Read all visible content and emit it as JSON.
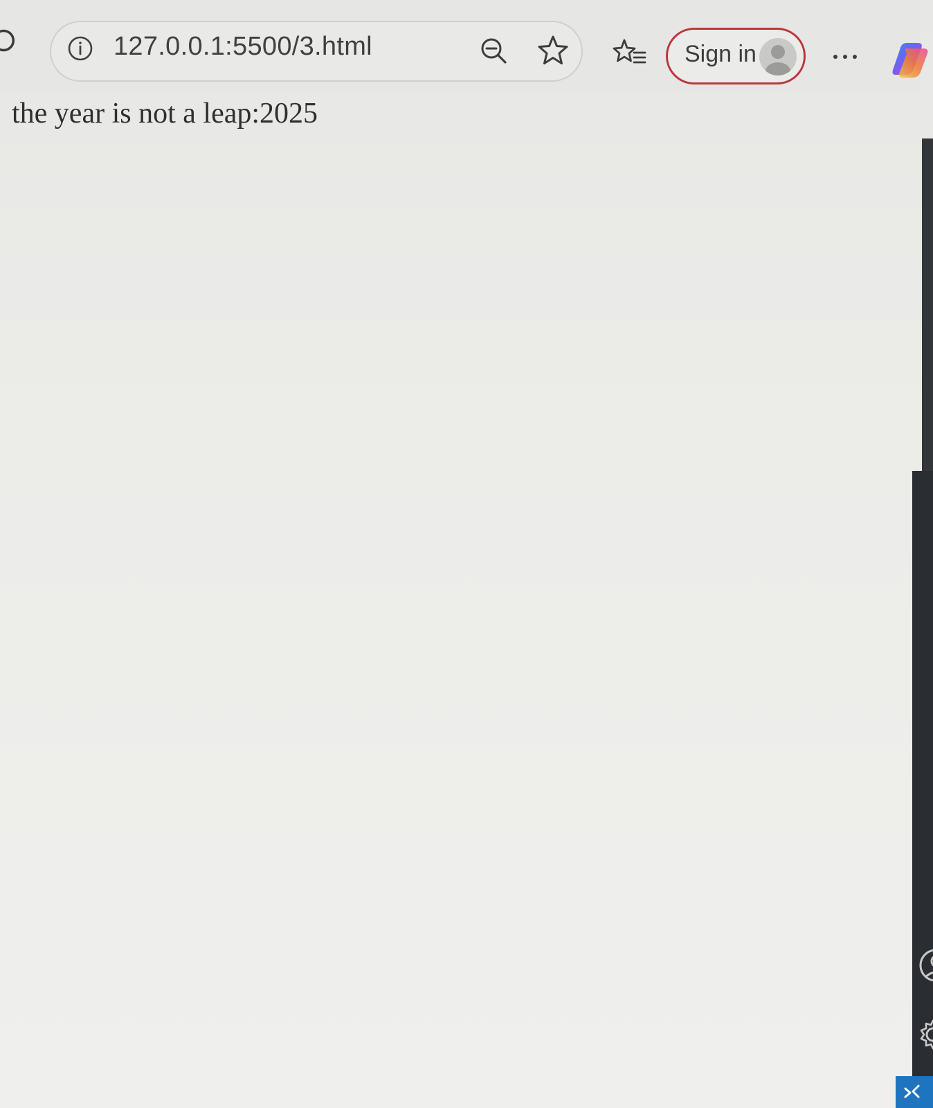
{
  "browser": {
    "address_bar": {
      "url": "127.0.0.1:5500/3.html"
    },
    "toolbar": {
      "signin_label": "Sign in",
      "icons": [
        "reload-icon",
        "info-icon",
        "zoom-out-icon",
        "star-icon",
        "favorites-icon",
        "avatar",
        "more-icon",
        "copilot-icon"
      ]
    },
    "side_panel": {
      "icons": [
        "user-icon",
        "gear-icon",
        "remote-icon"
      ],
      "accent_color": "#1f74c0"
    },
    "signin_border_color": "#b9383b"
  },
  "page": {
    "text": "the year is not a leap:2025"
  }
}
